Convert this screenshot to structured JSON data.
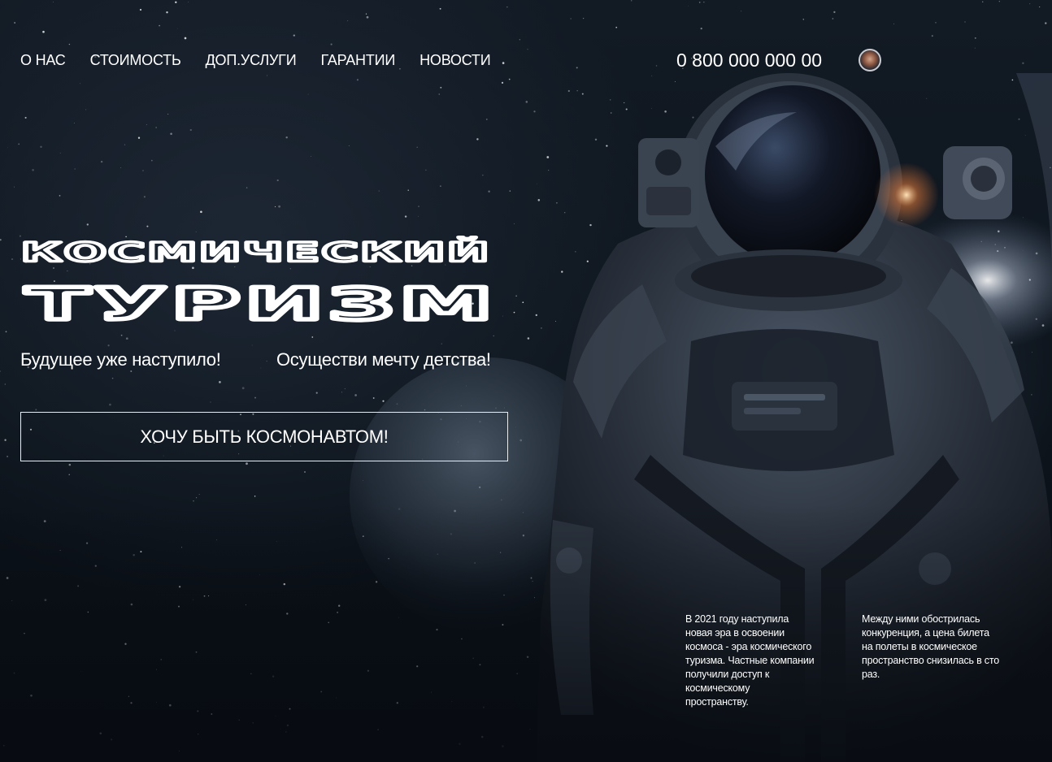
{
  "nav": {
    "items": [
      {
        "label": "О НАС"
      },
      {
        "label": "СТОИМОСТЬ"
      },
      {
        "label": "ДОП.УСЛУГИ"
      },
      {
        "label": "ГАРАНТИИ"
      },
      {
        "label": "НОВОСТИ"
      }
    ]
  },
  "header": {
    "phone": "0 800 000 000 00",
    "avatar_icon": "user-avatar-icon"
  },
  "hero": {
    "title_line1": "КОСМИЧЕСКИЙ",
    "title_line2": "ТУРИЗМ",
    "tagline_1": "Будущее уже наступило!",
    "tagline_2": "Осуществи мечту детства!",
    "cta_label": "ХОЧУ БЫТЬ КОСМОНАВТОМ!"
  },
  "info": {
    "block_1": "В 2021 году наступила новая эра в освоении космоса - эра космического туризма. Частные компании получили доступ к космическому пространству.",
    "block_2": "Между ними обострилась конкуренция, а цена билета на полеты в космическое пространство снизилась в сто раз."
  },
  "colors": {
    "background": "#0d141c",
    "text": "#ffffff",
    "button_border": "#e9ecef"
  }
}
